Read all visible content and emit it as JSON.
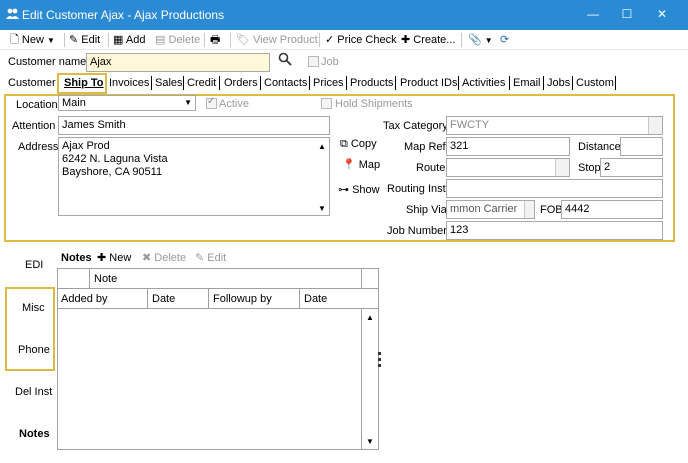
{
  "window": {
    "title": "Edit Customer Ajax - Ajax Productions",
    "minimize": "—",
    "maximize": "☐",
    "close": "✕"
  },
  "toolbar": {
    "new": "New",
    "edit": "Edit",
    "add": "Add",
    "delete": "Delete",
    "view_product": "View Product",
    "price_check": "Price Check",
    "create": "Create..."
  },
  "customer": {
    "label": "Customer name",
    "value": "Ajax",
    "job_label": "Job"
  },
  "tabs": [
    "Customer",
    "Ship To",
    "Invoices",
    "Sales",
    "Credit",
    "Orders",
    "Contacts",
    "Prices",
    "Products",
    "Product IDs",
    "Activities",
    "Email",
    "Jobs",
    "Custom"
  ],
  "shipto": {
    "location_label": "Location",
    "location_value": "Main",
    "active_label": "Active",
    "hold_label": "Hold Shipments",
    "attention_label": "Attention",
    "attention_value": "James Smith",
    "address_label": "Address",
    "address_lines": [
      "Ajax Prod",
      "6242 N. Laguna Vista",
      "Bayshore, CA 90511"
    ],
    "copy": "Copy",
    "map": "Map",
    "show": "Show",
    "tax_category_label": "Tax Category",
    "tax_category_value": "FWCTY",
    "map_ref_label": "Map Ref",
    "map_ref_value": "321",
    "distance_label": "Distance",
    "distance_value": "",
    "route_label": "Route",
    "route_value": "",
    "stop_label": "Stop",
    "stop_value": "2",
    "routing_inst_label": "Routing Inst",
    "routing_inst_value": "",
    "ship_via_label": "Ship Via",
    "ship_via_value": "mmon Carrier",
    "fob_label": "FOB",
    "fob_value": "4442",
    "job_number_label": "Job Number",
    "job_number_value": "123"
  },
  "side_tabs": [
    "EDI",
    "Misc",
    "Phone",
    "Del Inst",
    "Notes"
  ],
  "notes": {
    "title": "Notes",
    "new": "New",
    "delete": "Delete",
    "edit": "Edit",
    "note_col": "Note",
    "columns": [
      "Added by",
      "Date",
      "Followup by",
      "Date"
    ]
  },
  "colors": {
    "titlebar": "#2a8ad4",
    "highlight": "#d9bb45",
    "disabled": "#9a9a9a"
  }
}
